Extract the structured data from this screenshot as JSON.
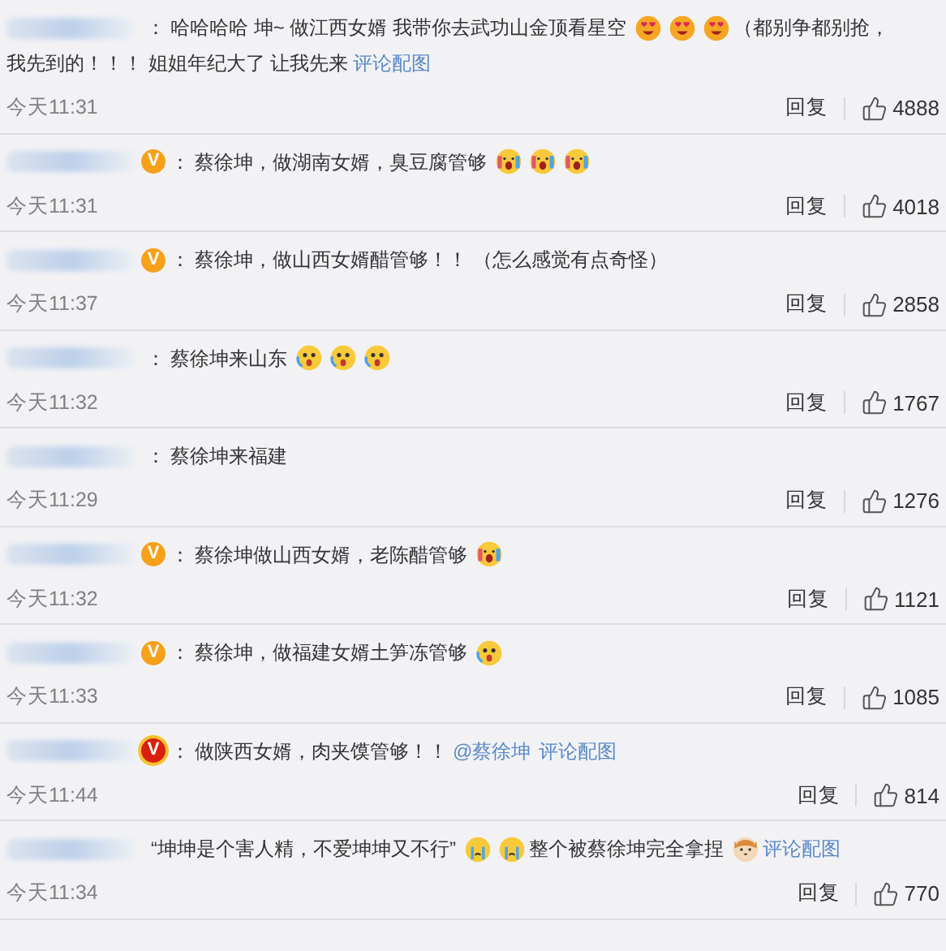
{
  "comments": [
    {
      "sep": "：",
      "segments": [
        {
          "kind": "text",
          "text": "哈哈哈哈 坤~ 做江西女婿 我带你去武功山金顶看星空"
        },
        {
          "kind": "love"
        },
        {
          "kind": "love"
        },
        {
          "kind": "love"
        },
        {
          "kind": "text",
          "text": "（都别争都别抢，"
        },
        {
          "kind": "text",
          "text": "我先到的！！！ 姐姐年纪大了 让我先来"
        },
        {
          "kind": "link",
          "text": "评论配图"
        }
      ],
      "time": "今天11:31",
      "reply": "回复",
      "likes": "4888"
    },
    {
      "badge": {
        "kind": "orange",
        "label": "V"
      },
      "sep": "：",
      "segments": [
        {
          "kind": "text",
          "text": "蔡徐坤，做湖南女婿，臭豆腐管够"
        },
        {
          "kind": "scream"
        },
        {
          "kind": "scream"
        },
        {
          "kind": "scream"
        }
      ],
      "time": "今天11:31",
      "reply": "回复",
      "likes": "4018"
    },
    {
      "badge": {
        "kind": "orange",
        "label": "V"
      },
      "sep": "：",
      "segments": [
        {
          "kind": "text",
          "text": "蔡徐坤，做山西女婿醋管够！！ （怎么感觉有点奇怪）"
        }
      ],
      "time": "今天11:37",
      "reply": "回复",
      "likes": "2858"
    },
    {
      "sep": "：",
      "segments": [
        {
          "kind": "text",
          "text": "蔡徐坤来山东"
        },
        {
          "kind": "fright"
        },
        {
          "kind": "fright"
        },
        {
          "kind": "fright"
        }
      ],
      "time": "今天11:32",
      "reply": "回复",
      "likes": "1767"
    },
    {
      "sep": "：",
      "segments": [
        {
          "kind": "text",
          "text": "蔡徐坤来福建"
        }
      ],
      "time": "今天11:29",
      "reply": "回复",
      "likes": "1276"
    },
    {
      "badge": {
        "kind": "orange",
        "label": "V"
      },
      "sep": "：",
      "segments": [
        {
          "kind": "text",
          "text": "蔡徐坤做山西女婿，老陈醋管够"
        },
        {
          "kind": "scream"
        }
      ],
      "time": "今天11:32",
      "reply": "回复",
      "likes": "1121"
    },
    {
      "badge": {
        "kind": "orange",
        "label": "V"
      },
      "sep": "：",
      "segments": [
        {
          "kind": "text",
          "text": "蔡徐坤，做福建女婿土笋冻管够"
        },
        {
          "kind": "fright"
        }
      ],
      "time": "今天11:33",
      "reply": "回复",
      "likes": "1085"
    },
    {
      "badge": {
        "kind": "red",
        "label": "V"
      },
      "sep": "：",
      "segments": [
        {
          "kind": "text",
          "text": "做陕西女婿，肉夹馍管够！！"
        },
        {
          "kind": "link",
          "text": "@蔡徐坤"
        },
        {
          "kind": "link",
          "text": "评论配图"
        }
      ],
      "time": "今天11:44",
      "reply": "回复",
      "likes": "814"
    },
    {
      "segments": [
        {
          "kind": "text",
          "text": "“坤坤是个害人精，不爱坤坤又不行”"
        },
        {
          "kind": "cry"
        },
        {
          "kind": "cry"
        },
        {
          "kind": "text",
          "text": "整个被蔡徐坤完全拿捏"
        },
        {
          "kind": "cat"
        },
        {
          "kind": "link",
          "text": "评论配图"
        }
      ],
      "time": "今天11:34",
      "reply": "回复",
      "likes": "770"
    }
  ]
}
